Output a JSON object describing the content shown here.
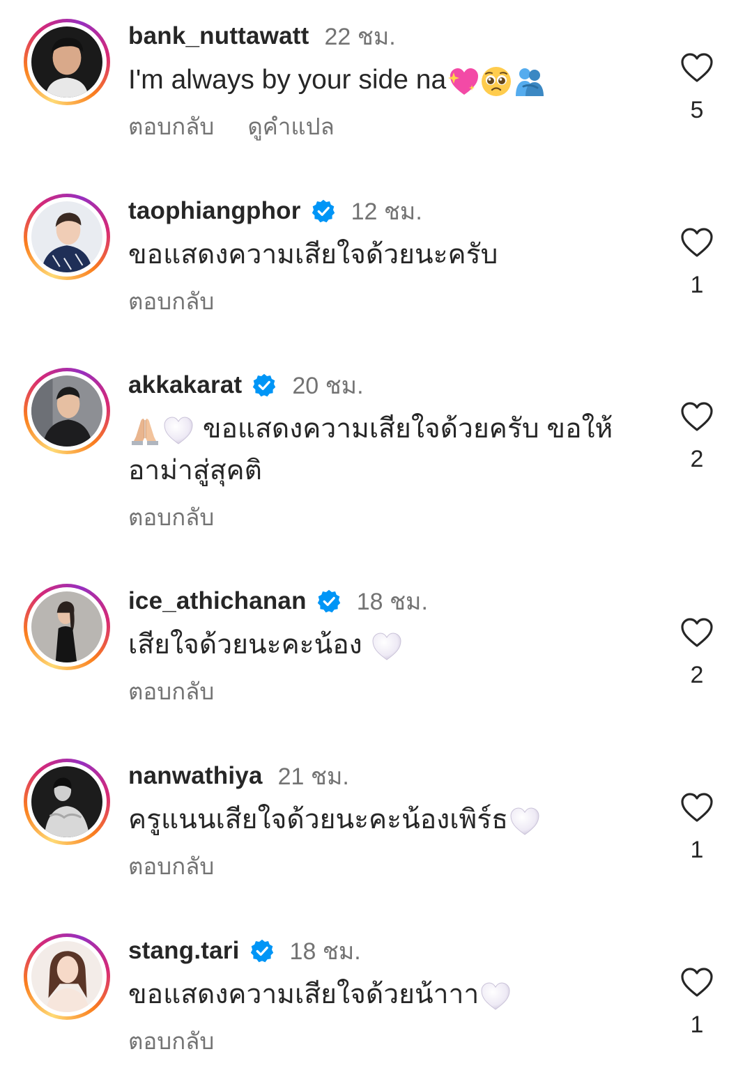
{
  "colors": {
    "text": "#262626",
    "muted": "#737373",
    "verified": "#0095f6",
    "story_ring": [
      "#feda75",
      "#fa7e1e",
      "#d62976",
      "#962fbf"
    ]
  },
  "comments": [
    {
      "username": "bank_nuttawatt",
      "verified": false,
      "time": "22 ชม.",
      "text": "I'm always by your side na",
      "emojis": [
        "sparkling-heart-emoji",
        "pleading-face-emoji",
        "people-hugging-emoji"
      ],
      "reply_label": "ตอบกลับ",
      "translate_label": "ดูคำแปล",
      "likes": "5"
    },
    {
      "username": "taophiangphor",
      "verified": true,
      "time": "12 ชม.",
      "text": "ขอแสดงความเสียใจด้วยนะครับ",
      "reply_label": "ตอบกลับ",
      "likes": "1"
    },
    {
      "username": "akkakarat",
      "verified": true,
      "time": "20 ชม.",
      "text_line1": "ขอแสดงความเสียใจด้วยครับ ขอให้",
      "text_line2": "อาม่าสู่สุคติ",
      "emojis": [
        "folded-hands-emoji",
        "white-heart-emoji"
      ],
      "reply_label": "ตอบกลับ",
      "likes": "2"
    },
    {
      "username": "ice_athichanan",
      "verified": true,
      "time": "18 ชม.",
      "text": "เสียใจด้วยนะคะน้อง",
      "emojis": [
        "white-heart-emoji"
      ],
      "reply_label": "ตอบกลับ",
      "likes": "2"
    },
    {
      "username": "nanwathiya",
      "verified": false,
      "time": "21 ชม.",
      "text": "ครูแนนเสียใจด้วยนะคะน้องเพิร์ธ",
      "emojis": [
        "white-heart-emoji"
      ],
      "reply_label": "ตอบกลับ",
      "likes": "1"
    },
    {
      "username": "stang.tari",
      "verified": true,
      "time": "18 ชม.",
      "text": "ขอแสดงความเสียใจด้วยน้าาา",
      "emojis": [
        "white-heart-emoji"
      ],
      "reply_label": "ตอบกลับ",
      "likes": "1"
    }
  ]
}
